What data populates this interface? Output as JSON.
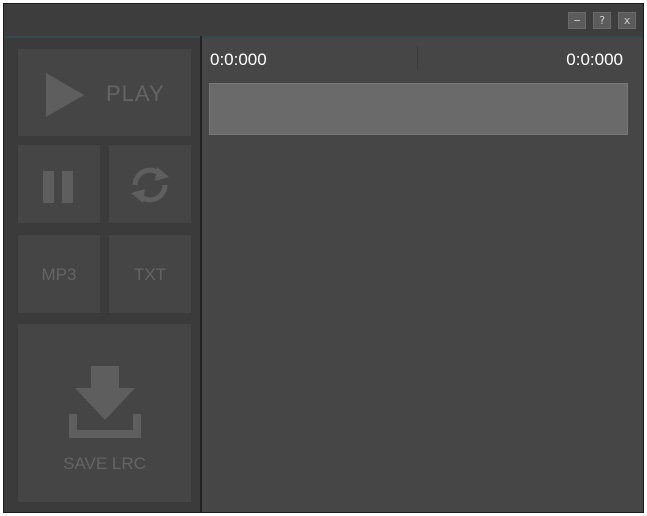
{
  "window": {
    "controls": {
      "minimize": "−",
      "help": "?",
      "close": "x"
    }
  },
  "sidebar": {
    "play_label": "PLAY",
    "mp3_label": "MP3",
    "txt_label": "TXT",
    "save_label": "SAVE LRC"
  },
  "timeline": {
    "start_time": "0:0:000",
    "end_time": "0:0:000"
  },
  "colors": {
    "window_bg": "#3a3a3a",
    "content_bg": "#464646",
    "tile_bg": "#454545",
    "tile_glyph": "#5e5e5e",
    "track_bar": "#6a6a6a",
    "accent_line": "#324a4a"
  }
}
